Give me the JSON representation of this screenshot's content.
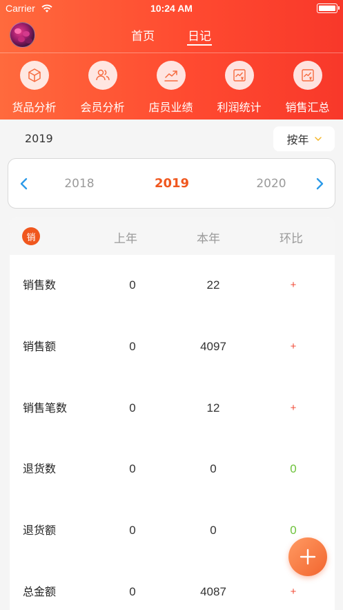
{
  "status": {
    "carrier": "Carrier",
    "time": "10:24 AM"
  },
  "nav": {
    "home": "首页",
    "diary": "日记",
    "active": "日记"
  },
  "quick": [
    {
      "label": "货品分析",
      "icon": "box-icon"
    },
    {
      "label": "会员分析",
      "icon": "users-icon"
    },
    {
      "label": "店员业绩",
      "icon": "trend-icon"
    },
    {
      "label": "利润统计",
      "icon": "profit-chart-icon"
    },
    {
      "label": "销售汇总",
      "icon": "sales-chart-icon"
    }
  ],
  "filter": {
    "year": "2019",
    "mode": "按年"
  },
  "year_picker": {
    "prev": "2018",
    "current": "2019",
    "next": "2020"
  },
  "table": {
    "badge": "销",
    "headers": [
      "上年",
      "本年",
      "环比"
    ],
    "rows": [
      {
        "name": "销售数",
        "prev": "0",
        "current": "22",
        "ratio": "+"
      },
      {
        "name": "销售额",
        "prev": "0",
        "current": "4097",
        "ratio": "+"
      },
      {
        "name": "销售笔数",
        "prev": "0",
        "current": "12",
        "ratio": "+"
      },
      {
        "name": "退货数",
        "prev": "0",
        "current": "0",
        "ratio": "0"
      },
      {
        "name": "退货额",
        "prev": "0",
        "current": "0",
        "ratio": "0"
      },
      {
        "name": "总金额",
        "prev": "0",
        "current": "4087",
        "ratio": "+"
      }
    ]
  },
  "colors": {
    "brand": "#ff4a30",
    "accent": "#f0571e",
    "increase": "#f04a36",
    "neutral": "#6cc23a",
    "link_blue": "#2b9ae8"
  }
}
